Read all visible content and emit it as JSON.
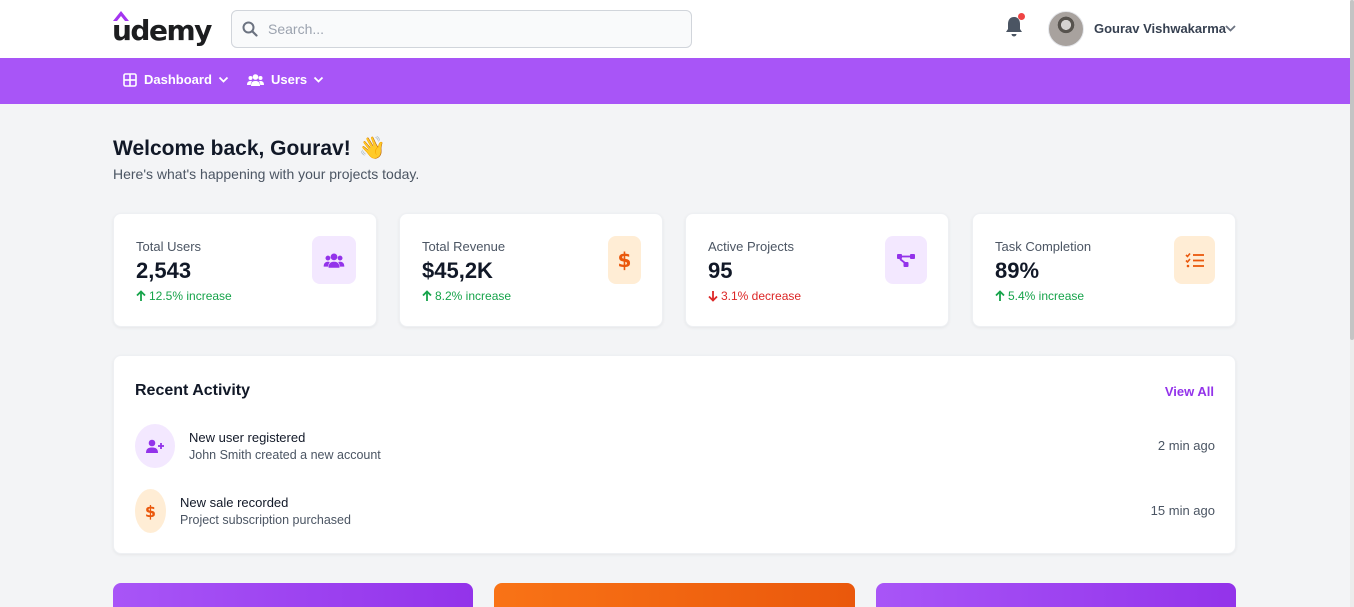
{
  "header": {
    "logo_text": "udemy",
    "search_placeholder": "Search...",
    "icons": [
      "search-icon",
      "bell-icon",
      "chevron-down-icon"
    ],
    "notification_dot_color": "#ef4444",
    "user_name": "Gourav Vishwakarma"
  },
  "nav": {
    "bar_color": "#a855f7",
    "items": [
      {
        "label": "Dashboard",
        "icon": "grid-icon"
      },
      {
        "label": "Users",
        "icon": "users-icon"
      }
    ]
  },
  "welcome": {
    "title": "Welcome back, Gourav!",
    "emoji": "👋",
    "subtitle": "Here's what's happening with your projects today."
  },
  "stats": [
    {
      "label": "Total Users",
      "value": "2,543",
      "change": "12.5% increase",
      "trend": "up",
      "icon": "users-icon",
      "accent": "purple"
    },
    {
      "label": "Total Revenue",
      "value": "$45,2K",
      "change": "8.2% increase",
      "trend": "up",
      "icon": "dollar-icon",
      "accent": "orange"
    },
    {
      "label": "Active Projects",
      "value": "95",
      "change": "3.1% decrease",
      "trend": "down",
      "icon": "project-diagram-icon",
      "accent": "purple"
    },
    {
      "label": "Task Completion",
      "value": "89%",
      "change": "5.4% increase",
      "trend": "up",
      "icon": "tasks-icon",
      "accent": "orange"
    }
  ],
  "colors": {
    "accent_purple": "#9333ea",
    "accent_orange": "#ea580c",
    "increase": "#16a34a",
    "decrease": "#dc2626"
  },
  "activity": {
    "title": "Recent Activity",
    "view_all": "View All",
    "items": [
      {
        "title": "New user registered",
        "detail": "John Smith created a new account",
        "time": "2 min ago",
        "icon": "user-plus-icon"
      },
      {
        "title": "New sale recorded",
        "detail": "Project subscription purchased",
        "time": "15 min ago",
        "icon": "dollar-icon"
      }
    ]
  }
}
